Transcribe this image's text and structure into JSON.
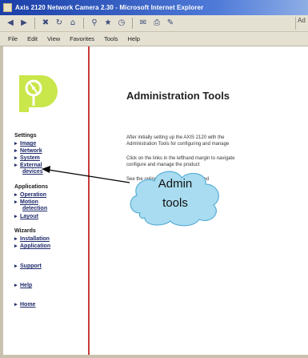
{
  "window": {
    "title": "Axis 2120 Network Camera 2.30 - Microsoft Internet Explorer"
  },
  "toolbar": {
    "icons": [
      "back-icon",
      "forward-icon",
      "stop-icon",
      "refresh-icon",
      "home-icon",
      "search-icon",
      "favorites-icon",
      "history-icon",
      "mail-icon",
      "print-icon",
      "edit-icon"
    ],
    "address_label": "Ad"
  },
  "menubar": {
    "items": [
      "File",
      "Edit",
      "View",
      "Favorites",
      "Tools",
      "Help"
    ]
  },
  "sidebar": {
    "settings_heading": "Settings",
    "settings_items": [
      "Image",
      "Network",
      "System",
      "External",
      "devices"
    ],
    "applications_heading": "Applications",
    "applications_items": [
      "Operation",
      "Motion",
      "detection",
      "Layout"
    ],
    "wizards_heading": "Wizards",
    "wizards_items": [
      "Installation",
      "Application"
    ],
    "support": "Support",
    "help": "Help",
    "home": "Home"
  },
  "main": {
    "title": "Administration Tools",
    "para1_line1": "After initially setting up the AXIS 2120 with the",
    "para1_line2": "Administration Tools for configuring and manage",
    "para2_line1": "Click on the links in the lefthand margin to navigate",
    "para2_line2": "configure and manage the product",
    "para3_line1": "See the online help for each supported"
  },
  "callout": {
    "line1": "Admin",
    "line2": "tools"
  },
  "colors": {
    "titlebar": "#1a3fa8",
    "chrome": "#e5e1d2",
    "link": "#1f2a6b",
    "sidebar_border": "#c93b3b",
    "logo": "#c9e64a",
    "cloud": "#a9dcf0"
  }
}
